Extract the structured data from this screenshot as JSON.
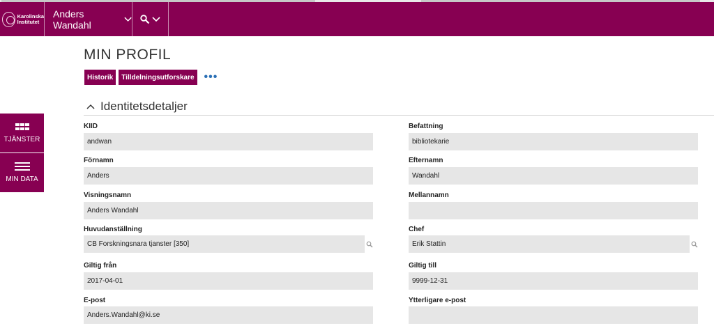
{
  "header": {
    "logo_text_line1": "Karolinska",
    "logo_text_line2": "Institutet",
    "user_name": "Anders Wandahl"
  },
  "sidenav": {
    "items": [
      {
        "label": "TJÄNSTER",
        "icon": "grid-icon"
      },
      {
        "label": "MIN DATA",
        "icon": "menu-icon"
      }
    ]
  },
  "page": {
    "title": "MIN PROFIL",
    "buttons": [
      "Historik",
      "Tilldelningsutforskare"
    ],
    "more_label": "•••"
  },
  "section": {
    "title": "Identitetsdetaljer"
  },
  "fields": {
    "kiid": {
      "label": "KIID",
      "value": "andwan"
    },
    "befattning": {
      "label": "Befattning",
      "value": "bibliotekarie"
    },
    "fornamn": {
      "label": "Förnamn",
      "value": "Anders"
    },
    "efternamn": {
      "label": "Efternamn",
      "value": "Wandahl"
    },
    "visningsnamn": {
      "label": "Visningsnamn",
      "value": "Anders Wandahl"
    },
    "mellannamn": {
      "label": "Mellannamn",
      "value": ""
    },
    "huvudanstallning": {
      "label": "Huvudanställning",
      "value": "CB Forskningsnara tjanster [350]"
    },
    "chef": {
      "label": "Chef",
      "value": "Erik Stattin"
    },
    "giltig_fran": {
      "label": "Giltig från",
      "value": "2017-04-01"
    },
    "giltig_till": {
      "label": "Giltig till",
      "value": "9999-12-31"
    },
    "epost": {
      "label": "E-post",
      "value": "Anders.Wandahl@ki.se"
    },
    "ytterligare_epost": {
      "label": "Ytterligare e-post",
      "value": ""
    }
  },
  "colors": {
    "brand": "#870052",
    "field_bg": "#e6e6e6",
    "link": "#2a6fb5"
  }
}
